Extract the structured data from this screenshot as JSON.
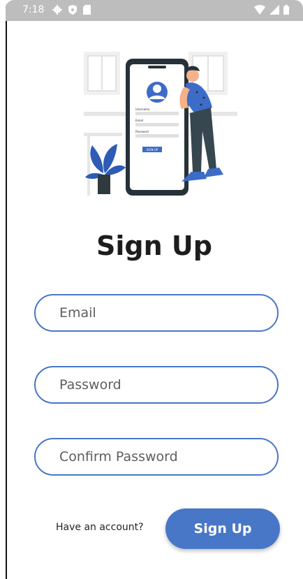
{
  "status_bar": {
    "time": "7:18",
    "icons": [
      "gear-icon",
      "shield-icon",
      "sim-card-icon",
      "wifi-icon",
      "signal-icon",
      "battery-icon"
    ]
  },
  "page": {
    "title": "Sign Up"
  },
  "form": {
    "email_placeholder": "Email",
    "email_value": "",
    "password_placeholder": "Password",
    "password_value": "",
    "confirm_placeholder": "Confirm Password",
    "confirm_value": ""
  },
  "footer": {
    "have_account": "Have an account?",
    "signup_label": "Sign Up"
  },
  "illustration": {
    "phone_title": "SIGN UP",
    "field_labels": [
      "Username",
      "Email",
      "Password"
    ]
  },
  "colors": {
    "accent": "#4877c7",
    "status_bar": "#bdbdbd",
    "title": "#1d1d1d",
    "plant": "#2d5bb5",
    "shirt": "#3d6cc8"
  }
}
